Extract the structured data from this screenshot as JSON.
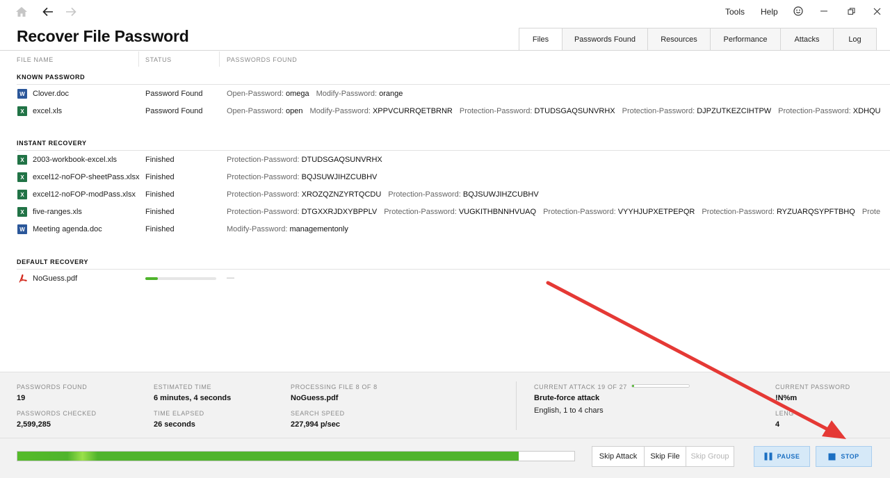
{
  "nav": {
    "tools_label": "Tools",
    "help_label": "Help"
  },
  "page": {
    "title": "Recover File Password"
  },
  "tabs": [
    {
      "label": "Files",
      "active": true
    },
    {
      "label": "Passwords Found",
      "active": false
    },
    {
      "label": "Resources",
      "active": false
    },
    {
      "label": "Performance",
      "active": false
    },
    {
      "label": "Attacks",
      "active": false
    },
    {
      "label": "Log",
      "active": false
    }
  ],
  "columns": {
    "file_name": "FILE NAME",
    "status": "STATUS",
    "passwords_found": "PASSWORDS FOUND"
  },
  "sections": {
    "known": {
      "title": "KNOWN PASSWORD",
      "files": [
        {
          "name": "Clover.doc",
          "type": "doc",
          "status": "Password Found",
          "passwords": [
            {
              "label": "Open-Password:",
              "value": "omega"
            },
            {
              "label": "Modify-Password:",
              "value": "orange"
            }
          ]
        },
        {
          "name": "excel.xls",
          "type": "xls",
          "status": "Password Found",
          "passwords": [
            {
              "label": "Open-Password:",
              "value": "open"
            },
            {
              "label": "Modify-Password:",
              "value": "XPPVCURRQETBRNR"
            },
            {
              "label": "Protection-Password:",
              "value": "DTUDSGAQSUNVRHX"
            },
            {
              "label": "Protection-Password:",
              "value": "DJPZUTKEZCIHTPW"
            },
            {
              "label": "Protection-Password:",
              "value": "XDHQUPUPFMHKSI"
            }
          ]
        }
      ]
    },
    "instant": {
      "title": "INSTANT RECOVERY",
      "files": [
        {
          "name": "2003-workbook-excel.xls",
          "type": "xls",
          "status": "Finished",
          "passwords": [
            {
              "label": "Protection-Password:",
              "value": "DTUDSGAQSUNVRHX"
            }
          ]
        },
        {
          "name": "excel12-noFOP-sheetPass.xlsx",
          "type": "xls",
          "status": "Finished",
          "passwords": [
            {
              "label": "Protection-Password:",
              "value": "BQJSUWJIHZCUBHV"
            }
          ]
        },
        {
          "name": "excel12-noFOP-modPass.xlsx",
          "type": "xls",
          "status": "Finished",
          "passwords": [
            {
              "label": "Protection-Password:",
              "value": "XROZQZNZYRTQCDU"
            },
            {
              "label": "Protection-Password:",
              "value": "BQJSUWJIHZCUBHV"
            }
          ]
        },
        {
          "name": "five-ranges.xls",
          "type": "xls",
          "status": "Finished",
          "passwords": [
            {
              "label": "Protection-Password:",
              "value": "DTGXXRJDXYBPPLV"
            },
            {
              "label": "Protection-Password:",
              "value": "VUGKITHBNNHVUAQ"
            },
            {
              "label": "Protection-Password:",
              "value": "VYYHJUPXETPEPQR"
            },
            {
              "label": "Protection-Password:",
              "value": "RYZUARQSYPFTBHQ"
            },
            {
              "label": "Protection-Passwor",
              "value": ""
            }
          ]
        },
        {
          "name": "Meeting agenda.doc",
          "type": "doc",
          "status": "Finished",
          "passwords": [
            {
              "label": "Modify-Password:",
              "value": "managementonly"
            }
          ]
        }
      ]
    },
    "default": {
      "title": "DEFAULT RECOVERY",
      "files": [
        {
          "name": "NoGuess.pdf",
          "type": "pdf",
          "progress": 0.18,
          "passwords_placeholder": "—"
        }
      ]
    }
  },
  "stats": {
    "passwords_found_label": "PASSWORDS FOUND",
    "passwords_found": "19",
    "passwords_checked_label": "PASSWORDS CHECKED",
    "passwords_checked": "2,599,285",
    "estimated_time_label": "ESTIMATED TIME",
    "estimated_time": "6 minutes, 4 seconds",
    "time_elapsed_label": "TIME ELAPSED",
    "time_elapsed": "26 seconds",
    "processing_file_label": "PROCESSING FILE 8 OF 8",
    "processing_file": "NoGuess.pdf",
    "search_speed_label": "SEARCH SPEED",
    "search_speed": "227,994 p/sec",
    "current_attack_label": "CURRENT ATTACK 19 OF 27",
    "current_attack": "Brute-force attack",
    "current_attack_detail": "English, 1 to 4 chars",
    "current_attack_progress": 0.04,
    "current_password_label": "CURRENT PASSWORD",
    "current_password": "!N%m",
    "length_label": "LENG",
    "length": "4"
  },
  "bottom": {
    "overall_progress": 0.9,
    "skip_attack": "Skip Attack",
    "skip_file": "Skip File",
    "skip_group": "Skip Group",
    "pause": "PAUSE",
    "stop": "STOP"
  },
  "colors": {
    "accent_green": "#4fb42c",
    "button_blue": "#1b6fc2",
    "annotation_red": "#e53935"
  }
}
